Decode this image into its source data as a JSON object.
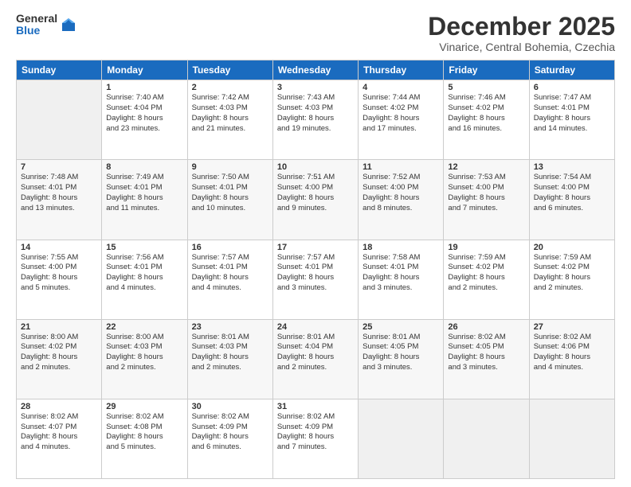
{
  "logo": {
    "general": "General",
    "blue": "Blue"
  },
  "title": "December 2025",
  "subtitle": "Vinarice, Central Bohemia, Czechia",
  "days_header": [
    "Sunday",
    "Monday",
    "Tuesday",
    "Wednesday",
    "Thursday",
    "Friday",
    "Saturday"
  ],
  "weeks": [
    [
      {
        "day": "",
        "info": ""
      },
      {
        "day": "1",
        "info": "Sunrise: 7:40 AM\nSunset: 4:04 PM\nDaylight: 8 hours\nand 23 minutes."
      },
      {
        "day": "2",
        "info": "Sunrise: 7:42 AM\nSunset: 4:03 PM\nDaylight: 8 hours\nand 21 minutes."
      },
      {
        "day": "3",
        "info": "Sunrise: 7:43 AM\nSunset: 4:03 PM\nDaylight: 8 hours\nand 19 minutes."
      },
      {
        "day": "4",
        "info": "Sunrise: 7:44 AM\nSunset: 4:02 PM\nDaylight: 8 hours\nand 17 minutes."
      },
      {
        "day": "5",
        "info": "Sunrise: 7:46 AM\nSunset: 4:02 PM\nDaylight: 8 hours\nand 16 minutes."
      },
      {
        "day": "6",
        "info": "Sunrise: 7:47 AM\nSunset: 4:01 PM\nDaylight: 8 hours\nand 14 minutes."
      }
    ],
    [
      {
        "day": "7",
        "info": "Sunrise: 7:48 AM\nSunset: 4:01 PM\nDaylight: 8 hours\nand 13 minutes."
      },
      {
        "day": "8",
        "info": "Sunrise: 7:49 AM\nSunset: 4:01 PM\nDaylight: 8 hours\nand 11 minutes."
      },
      {
        "day": "9",
        "info": "Sunrise: 7:50 AM\nSunset: 4:01 PM\nDaylight: 8 hours\nand 10 minutes."
      },
      {
        "day": "10",
        "info": "Sunrise: 7:51 AM\nSunset: 4:00 PM\nDaylight: 8 hours\nand 9 minutes."
      },
      {
        "day": "11",
        "info": "Sunrise: 7:52 AM\nSunset: 4:00 PM\nDaylight: 8 hours\nand 8 minutes."
      },
      {
        "day": "12",
        "info": "Sunrise: 7:53 AM\nSunset: 4:00 PM\nDaylight: 8 hours\nand 7 minutes."
      },
      {
        "day": "13",
        "info": "Sunrise: 7:54 AM\nSunset: 4:00 PM\nDaylight: 8 hours\nand 6 minutes."
      }
    ],
    [
      {
        "day": "14",
        "info": "Sunrise: 7:55 AM\nSunset: 4:00 PM\nDaylight: 8 hours\nand 5 minutes."
      },
      {
        "day": "15",
        "info": "Sunrise: 7:56 AM\nSunset: 4:01 PM\nDaylight: 8 hours\nand 4 minutes."
      },
      {
        "day": "16",
        "info": "Sunrise: 7:57 AM\nSunset: 4:01 PM\nDaylight: 8 hours\nand 4 minutes."
      },
      {
        "day": "17",
        "info": "Sunrise: 7:57 AM\nSunset: 4:01 PM\nDaylight: 8 hours\nand 3 minutes."
      },
      {
        "day": "18",
        "info": "Sunrise: 7:58 AM\nSunset: 4:01 PM\nDaylight: 8 hours\nand 3 minutes."
      },
      {
        "day": "19",
        "info": "Sunrise: 7:59 AM\nSunset: 4:02 PM\nDaylight: 8 hours\nand 2 minutes."
      },
      {
        "day": "20",
        "info": "Sunrise: 7:59 AM\nSunset: 4:02 PM\nDaylight: 8 hours\nand 2 minutes."
      }
    ],
    [
      {
        "day": "21",
        "info": "Sunrise: 8:00 AM\nSunset: 4:02 PM\nDaylight: 8 hours\nand 2 minutes."
      },
      {
        "day": "22",
        "info": "Sunrise: 8:00 AM\nSunset: 4:03 PM\nDaylight: 8 hours\nand 2 minutes."
      },
      {
        "day": "23",
        "info": "Sunrise: 8:01 AM\nSunset: 4:03 PM\nDaylight: 8 hours\nand 2 minutes."
      },
      {
        "day": "24",
        "info": "Sunrise: 8:01 AM\nSunset: 4:04 PM\nDaylight: 8 hours\nand 2 minutes."
      },
      {
        "day": "25",
        "info": "Sunrise: 8:01 AM\nSunset: 4:05 PM\nDaylight: 8 hours\nand 3 minutes."
      },
      {
        "day": "26",
        "info": "Sunrise: 8:02 AM\nSunset: 4:05 PM\nDaylight: 8 hours\nand 3 minutes."
      },
      {
        "day": "27",
        "info": "Sunrise: 8:02 AM\nSunset: 4:06 PM\nDaylight: 8 hours\nand 4 minutes."
      }
    ],
    [
      {
        "day": "28",
        "info": "Sunrise: 8:02 AM\nSunset: 4:07 PM\nDaylight: 8 hours\nand 4 minutes."
      },
      {
        "day": "29",
        "info": "Sunrise: 8:02 AM\nSunset: 4:08 PM\nDaylight: 8 hours\nand 5 minutes."
      },
      {
        "day": "30",
        "info": "Sunrise: 8:02 AM\nSunset: 4:09 PM\nDaylight: 8 hours\nand 6 minutes."
      },
      {
        "day": "31",
        "info": "Sunrise: 8:02 AM\nSunset: 4:09 PM\nDaylight: 8 hours\nand 7 minutes."
      },
      {
        "day": "",
        "info": ""
      },
      {
        "day": "",
        "info": ""
      },
      {
        "day": "",
        "info": ""
      }
    ]
  ]
}
